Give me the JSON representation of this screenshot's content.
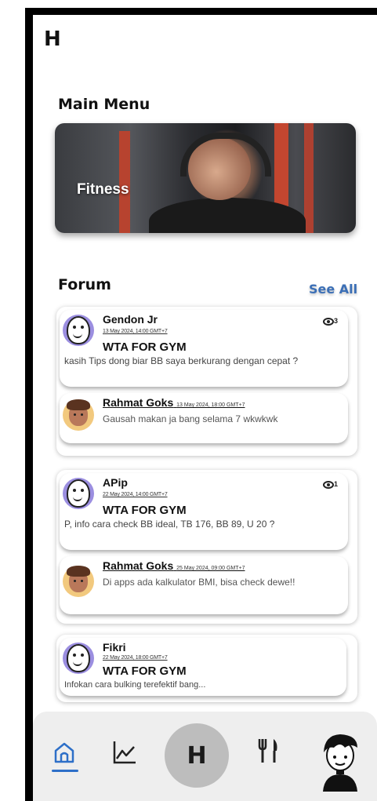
{
  "app": {
    "logo": "H"
  },
  "main_menu": {
    "title": "Main Menu",
    "card_label": "Fitness"
  },
  "forum": {
    "title": "Forum",
    "see_all": "See All",
    "threads": [
      {
        "name": "Gendon Jr",
        "date": "13 May 2024, 14:00 GMT+7",
        "title": "WTA FOR GYM",
        "body": "kasih Tips dong biar BB saya berkurang dengan cepat  ?",
        "views": "3",
        "reply": {
          "name": "Rahmat Goks",
          "date": "13 May 2024, 18:00 GMT+7",
          "body": "Gausah makan ja bang selama 7 wkwkwk"
        }
      },
      {
        "name": "APip",
        "date": "22 May 2024, 14:00 GMT+7",
        "title": "WTA FOR GYM",
        "body": "P, info cara check BB ideal, TB 176, BB 89, U 20 ?",
        "views": "1",
        "reply": {
          "name": "Rahmat Goks",
          "date": "25 May 2024, 09:00 GMT+7",
          "body": "Di apps ada kalkulator BMI, bisa check dewe!!"
        }
      },
      {
        "name": "Fikri",
        "date": "22 May 2024, 18:00 GMT+7",
        "title": "WTA FOR GYM",
        "body": "Infokan cara bulking terefektif bang..."
      }
    ]
  },
  "nav": {
    "center_label": "H",
    "items": [
      "home-icon",
      "chart-icon",
      "h-logo",
      "fork-knife-icon",
      "profile-avatar-icon"
    ],
    "active": "home"
  },
  "colors": {
    "accent": "#2d6fc8",
    "see_all": "#3b6fb6",
    "avatar_purple": "#9b8ee0",
    "avatar_orange": "#f2c97e"
  }
}
